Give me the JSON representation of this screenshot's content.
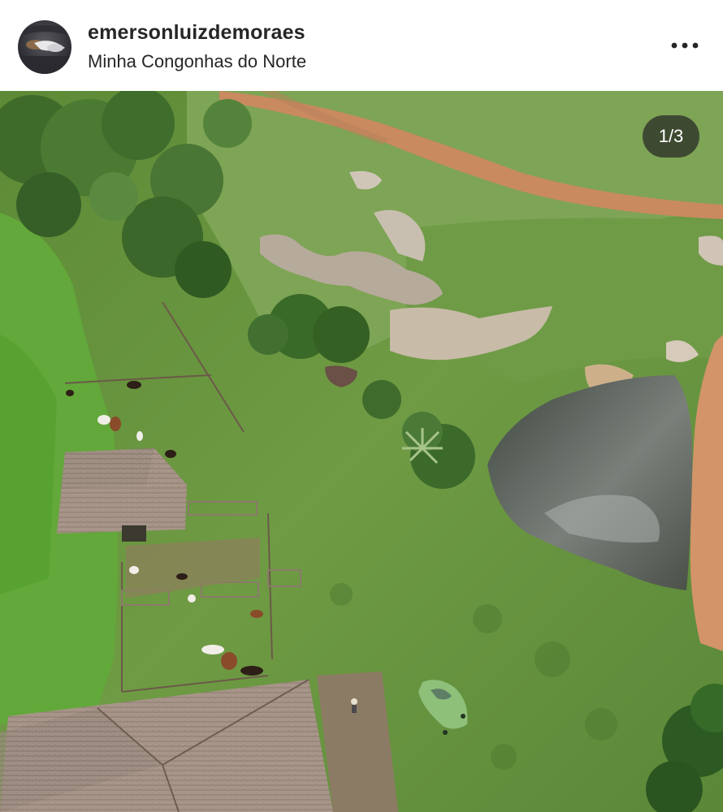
{
  "post": {
    "username": "emersonluizdemoraes",
    "location": "Minha Congonhas do Norte",
    "carousel": {
      "counter": "1/3",
      "current": 1,
      "total": 3
    }
  },
  "icons": {
    "more": "more-horizontal-icon"
  },
  "colors": {
    "text": "#262626",
    "badge_bg": "#262626",
    "grass": "#6a9a3c",
    "dirt_road": "#c98a60",
    "pond": "#5c6258"
  }
}
